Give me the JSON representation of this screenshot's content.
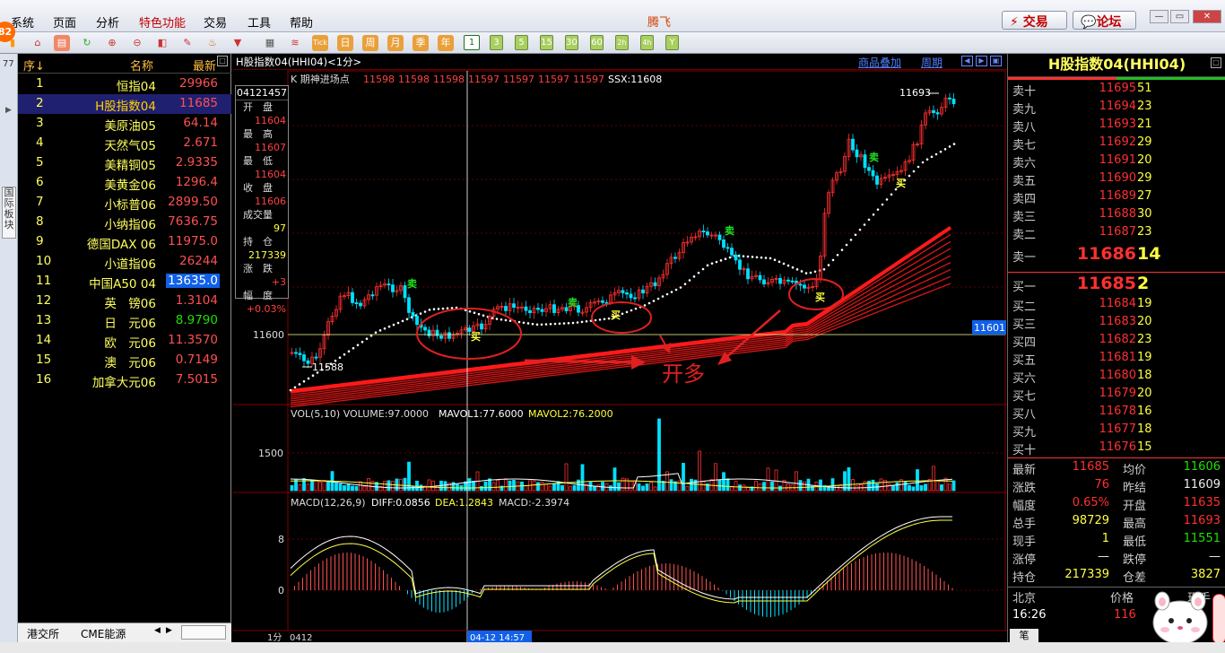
{
  "menubar": {
    "items": [
      "系统",
      "页面",
      "分析",
      "特色功能",
      "交易",
      "工具",
      "帮助"
    ],
    "app_title": "腾飞",
    "trade_button": "交易",
    "forum_button": "论坛",
    "badge": "82"
  },
  "toolbar": {
    "tick_label": "Tick",
    "period_buttons": [
      "日",
      "周",
      "月",
      "季",
      "年"
    ],
    "minute_buttons": [
      "1",
      "3",
      "5",
      "15",
      "30",
      "60",
      "2h",
      "4h",
      "Y"
    ]
  },
  "leftstrip": {
    "number": "77",
    "tab_label": "国际板块"
  },
  "list": {
    "headers": {
      "idx": "序↓",
      "name": "名称",
      "price": "最新"
    },
    "rows": [
      {
        "idx": "1",
        "name": "恒指04",
        "price": "29966"
      },
      {
        "idx": "2",
        "name": "H股指数04",
        "price": "11685"
      },
      {
        "idx": "3",
        "name": "美原油05",
        "price": "64.14"
      },
      {
        "idx": "4",
        "name": "天然气05",
        "price": "2.671"
      },
      {
        "idx": "5",
        "name": "美精铜05",
        "price": "2.9335"
      },
      {
        "idx": "6",
        "name": "美黄金06",
        "price": "1296.4"
      },
      {
        "idx": "7",
        "name": "小标普06",
        "price": "2899.50"
      },
      {
        "idx": "8",
        "name": "小纳指06",
        "price": "7636.75"
      },
      {
        "idx": "9",
        "name": "德国DAX 06",
        "price": "11975.0"
      },
      {
        "idx": "10",
        "name": "小道指06",
        "price": "26244"
      },
      {
        "idx": "11",
        "name": "中国A50 04",
        "price": "13635.0"
      },
      {
        "idx": "12",
        "name": "英　镑06",
        "price": "1.3104"
      },
      {
        "idx": "13",
        "name": "日　元06",
        "price": "8.9790"
      },
      {
        "idx": "14",
        "name": "欧　元06",
        "price": "11.3570"
      },
      {
        "idx": "15",
        "name": "澳　元06",
        "price": "0.7149"
      },
      {
        "idx": "16",
        "name": "加拿大元06",
        "price": "7.5015"
      }
    ],
    "bottom_tabs": [
      "港交所",
      "CME能源"
    ]
  },
  "chart": {
    "title": "H股指数04(HHI04)<1分>",
    "links": [
      "商品叠加",
      "周期"
    ],
    "indicator_line": "K  期神进场点",
    "indicator_values": [
      "11598",
      "11598",
      "11598",
      "11597",
      "11597",
      "11597",
      "11597"
    ],
    "ssx": "SSX:11608",
    "info_box": {
      "time": "04121457",
      "open_label": "开　盘",
      "open": "11604",
      "high_label": "最　高",
      "high": "11607",
      "low_label": "最　低",
      "low": "11604",
      "close_label": "收　盘",
      "close": "11606",
      "vol_label": "成交量",
      "vol": "97",
      "oi_label": "持　仓",
      "oi": "217339",
      "chg_label": "涨　跌",
      "chg": "+3",
      "pct_label": "幅　度",
      "pct": "+0.03%"
    },
    "price_ticks": {
      "main": "11600",
      "high": "11693",
      "low": "11588",
      "current": "11601"
    },
    "signals": {
      "sell": "卖",
      "buy": "买"
    },
    "annotation_text": "开多",
    "vol_header": {
      "label": "VOL(5,10) VOLUME:97.0000",
      "mavol1": "MAVOL1:77.6000",
      "mavol2": "MAVOL2:76.2000"
    },
    "vol_tick": "1500",
    "macd_header": {
      "label": "MACD(12,26,9)",
      "diff": "DIFF:0.0856",
      "dea": "DEA:1.2843",
      "macd": "MACD:-2.3974"
    },
    "macd_ticks": [
      "8",
      "0"
    ],
    "x_labels": {
      "left": "1分",
      "date": "0412",
      "cursor": "04-12 14:57"
    }
  },
  "quote": {
    "title": "H股指数04(HHI04)",
    "asks": [
      {
        "label": "卖十",
        "price": "11695",
        "vol": "51"
      },
      {
        "label": "卖九",
        "price": "11694",
        "vol": "23"
      },
      {
        "label": "卖八",
        "price": "11693",
        "vol": "21"
      },
      {
        "label": "卖七",
        "price": "11692",
        "vol": "29"
      },
      {
        "label": "卖六",
        "price": "11691",
        "vol": "20"
      },
      {
        "label": "卖五",
        "price": "11690",
        "vol": "29"
      },
      {
        "label": "卖四",
        "price": "11689",
        "vol": "27"
      },
      {
        "label": "卖三",
        "price": "11688",
        "vol": "30"
      },
      {
        "label": "卖二",
        "price": "11687",
        "vol": "23"
      },
      {
        "label": "卖一",
        "price": "11686",
        "vol": "14"
      }
    ],
    "bids": [
      {
        "label": "买一",
        "price": "11685",
        "vol": "2"
      },
      {
        "label": "买二",
        "price": "11684",
        "vol": "19"
      },
      {
        "label": "买三",
        "price": "11683",
        "vol": "20"
      },
      {
        "label": "买四",
        "price": "11682",
        "vol": "23"
      },
      {
        "label": "买五",
        "price": "11681",
        "vol": "19"
      },
      {
        "label": "买六",
        "price": "11680",
        "vol": "18"
      },
      {
        "label": "买七",
        "price": "11679",
        "vol": "20"
      },
      {
        "label": "买八",
        "price": "11678",
        "vol": "16"
      },
      {
        "label": "买九",
        "price": "11677",
        "vol": "18"
      },
      {
        "label": "买十",
        "price": "11676",
        "vol": "15"
      }
    ],
    "stats": [
      {
        "l1": "最新",
        "v1": "11685",
        "l2": "均价",
        "v2": "11606"
      },
      {
        "l1": "涨跌",
        "v1": "76",
        "l2": "昨结",
        "v2": "11609"
      },
      {
        "l1": "幅度",
        "v1": "0.65%",
        "l2": "开盘",
        "v2": "11635"
      },
      {
        "l1": "总手",
        "v1": "98729",
        "l2": "最高",
        "v2": "11693"
      },
      {
        "l1": "现手",
        "v1": "1",
        "l2": "最低",
        "v2": "11551"
      },
      {
        "l1": "涨停",
        "v1": "—",
        "l2": "跌停",
        "v2": "—"
      },
      {
        "l1": "持仓",
        "v1": "217339",
        "l2": "仓差",
        "v2": "3827"
      }
    ],
    "tick_header": {
      "place": "北京",
      "price": "价格",
      "now": "现手"
    },
    "tick_time": "16:26",
    "tick_price": "116",
    "tab_label": "笔"
  },
  "colors": {
    "up": "#ff3030",
    "down": "#00e0ff",
    "ma": "#ff2020",
    "sar": "#ffffff",
    "yellow": "#ffff40"
  }
}
